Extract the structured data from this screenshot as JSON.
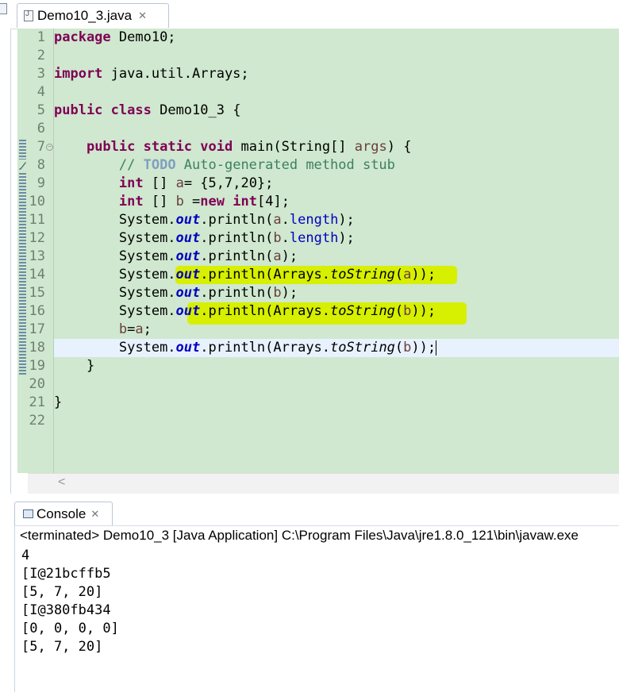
{
  "editor": {
    "tab_label": "Demo10_3.java",
    "line_numbers": [
      "1",
      "2",
      "3",
      "4",
      "5",
      "6",
      "7",
      "8",
      "9",
      "10",
      "11",
      "12",
      "13",
      "14",
      "15",
      "16",
      "17",
      "18",
      "19",
      "20",
      "21",
      "22"
    ],
    "code": {
      "l1_kw": "package",
      "l1_rest": " Demo10;",
      "l3_kw": "import",
      "l3_rest": " java.util.Arrays;",
      "l5_kw1": "public",
      "l5_kw2": "class",
      "l5_rest": " Demo10_3 {",
      "l7_indent": "    ",
      "l7_kw1": "public",
      "l7_kw2": "static",
      "l7_kw3": "void",
      "l7_mid": " main(String[] ",
      "l7_var": "args",
      "l7_end": ") {",
      "l8_indent": "        ",
      "l8_cmt1": "// ",
      "l8_todo": "TODO",
      "l8_cmt2": " Auto-generated method stub",
      "l9_indent": "        ",
      "l9_kw": "int",
      "l9_mid": " [] ",
      "l9_var": "a",
      "l9_end": "= {5,7,20};",
      "l10_indent": "        ",
      "l10_kw": "int",
      "l10_mid": " [] ",
      "l10_var": "b",
      "l10_eq": " =",
      "l10_kw2": "new",
      "l10_sp": " ",
      "l10_kw3": "int",
      "l10_end": "[4];",
      "l11_indent": "        ",
      "l11_sys": "System.",
      "l11_out": "out",
      "l11_call": ".println(",
      "l11_var": "a",
      "l11_dot": ".",
      "l11_fld": "length",
      "l11_end": ");",
      "l12_indent": "        ",
      "l12_sys": "System.",
      "l12_out": "out",
      "l12_call": ".println(",
      "l12_var": "b",
      "l12_dot": ".",
      "l12_fld": "length",
      "l12_end": ");",
      "l13_indent": "        ",
      "l13_sys": "System.",
      "l13_out": "out",
      "l13_call": ".println(",
      "l13_var": "a",
      "l13_end": ");",
      "l14_indent": "        ",
      "l14_sys": "System.",
      "l14_out": "out",
      "l14_call": ".println(Arrays.",
      "l14_meth": "toString",
      "l14_open": "(",
      "l14_var": "a",
      "l14_end": "));",
      "l15_indent": "        ",
      "l15_sys": "System.",
      "l15_out": "out",
      "l15_call": ".println(",
      "l15_var": "b",
      "l15_end": ");",
      "l16_indent": "        ",
      "l16_sys": "System.",
      "l16_out": "out",
      "l16_call": ".println(Arrays.",
      "l16_meth": "toString",
      "l16_open": "(",
      "l16_var": "b",
      "l16_end": "));",
      "l17_indent": "        ",
      "l17_var1": "b",
      "l17_eq": "=",
      "l17_var2": "a",
      "l17_end": ";",
      "l18_indent": "        ",
      "l18_sys": "System.",
      "l18_out": "out",
      "l18_call": ".println(Arrays.",
      "l18_meth": "toString",
      "l18_open": "(",
      "l18_var": "b",
      "l18_end": "));",
      "l19": "    }",
      "l21": "}"
    }
  },
  "console": {
    "tab_label": "Console",
    "status": "<terminated> Demo10_3 [Java Application] C:\\Program Files\\Java\\jre1.8.0_121\\bin\\javaw.exe",
    "output": [
      "4",
      "[I@21bcffb5",
      "[5, 7, 20]",
      "[I@380fb434",
      "[0, 0, 0, 0]",
      "[5, 7, 20]"
    ]
  },
  "colors": {
    "editor_bg": "#cfe8cf",
    "current_line": "#e8f2fe",
    "highlighter": "#d7ef00",
    "keyword": "#7f0055",
    "field": "#0000c0",
    "local_var": "#6a3e3e",
    "comment": "#3f7f5f",
    "todo": "#7f9fbf"
  },
  "icons": {
    "editor_tab": "java-file-icon",
    "console_tab": "console-icon",
    "close": "close-icon",
    "fold": "fold-collapse-icon",
    "scroll_left": "chevron-left-icon"
  }
}
